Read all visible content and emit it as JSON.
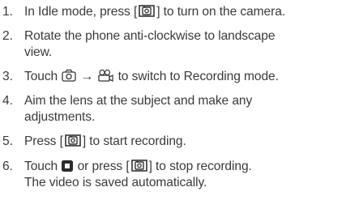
{
  "steps": [
    {
      "number": "1.",
      "before": "In Idle mode, press [",
      "after": "] to turn on the camera.",
      "key_icon": "camera-key-icon"
    },
    {
      "number": "2.",
      "line1": "Rotate the phone anti-clockwise to landscape",
      "line2": "view."
    },
    {
      "number": "3.",
      "before": "Touch",
      "arrow": "→",
      "after": "to switch to Recording mode.",
      "icon1": "camera-mode-icon",
      "icon2": "camcorder-mode-icon"
    },
    {
      "number": "4.",
      "line1": "Aim the lens at the subject and make any",
      "line2": "adjustments."
    },
    {
      "number": "5.",
      "before": "Press [",
      "after": "] to start recording.",
      "key_icon": "camera-key-icon"
    },
    {
      "number": "6.",
      "before": "Touch",
      "middle": "or press [",
      "after": "] to stop recording.",
      "line2": "The video is saved automatically.",
      "icon1": "stop-icon",
      "key_icon": "camera-key-icon"
    }
  ],
  "colors": {
    "text": "#3a3a3a",
    "icon": "#333333"
  }
}
